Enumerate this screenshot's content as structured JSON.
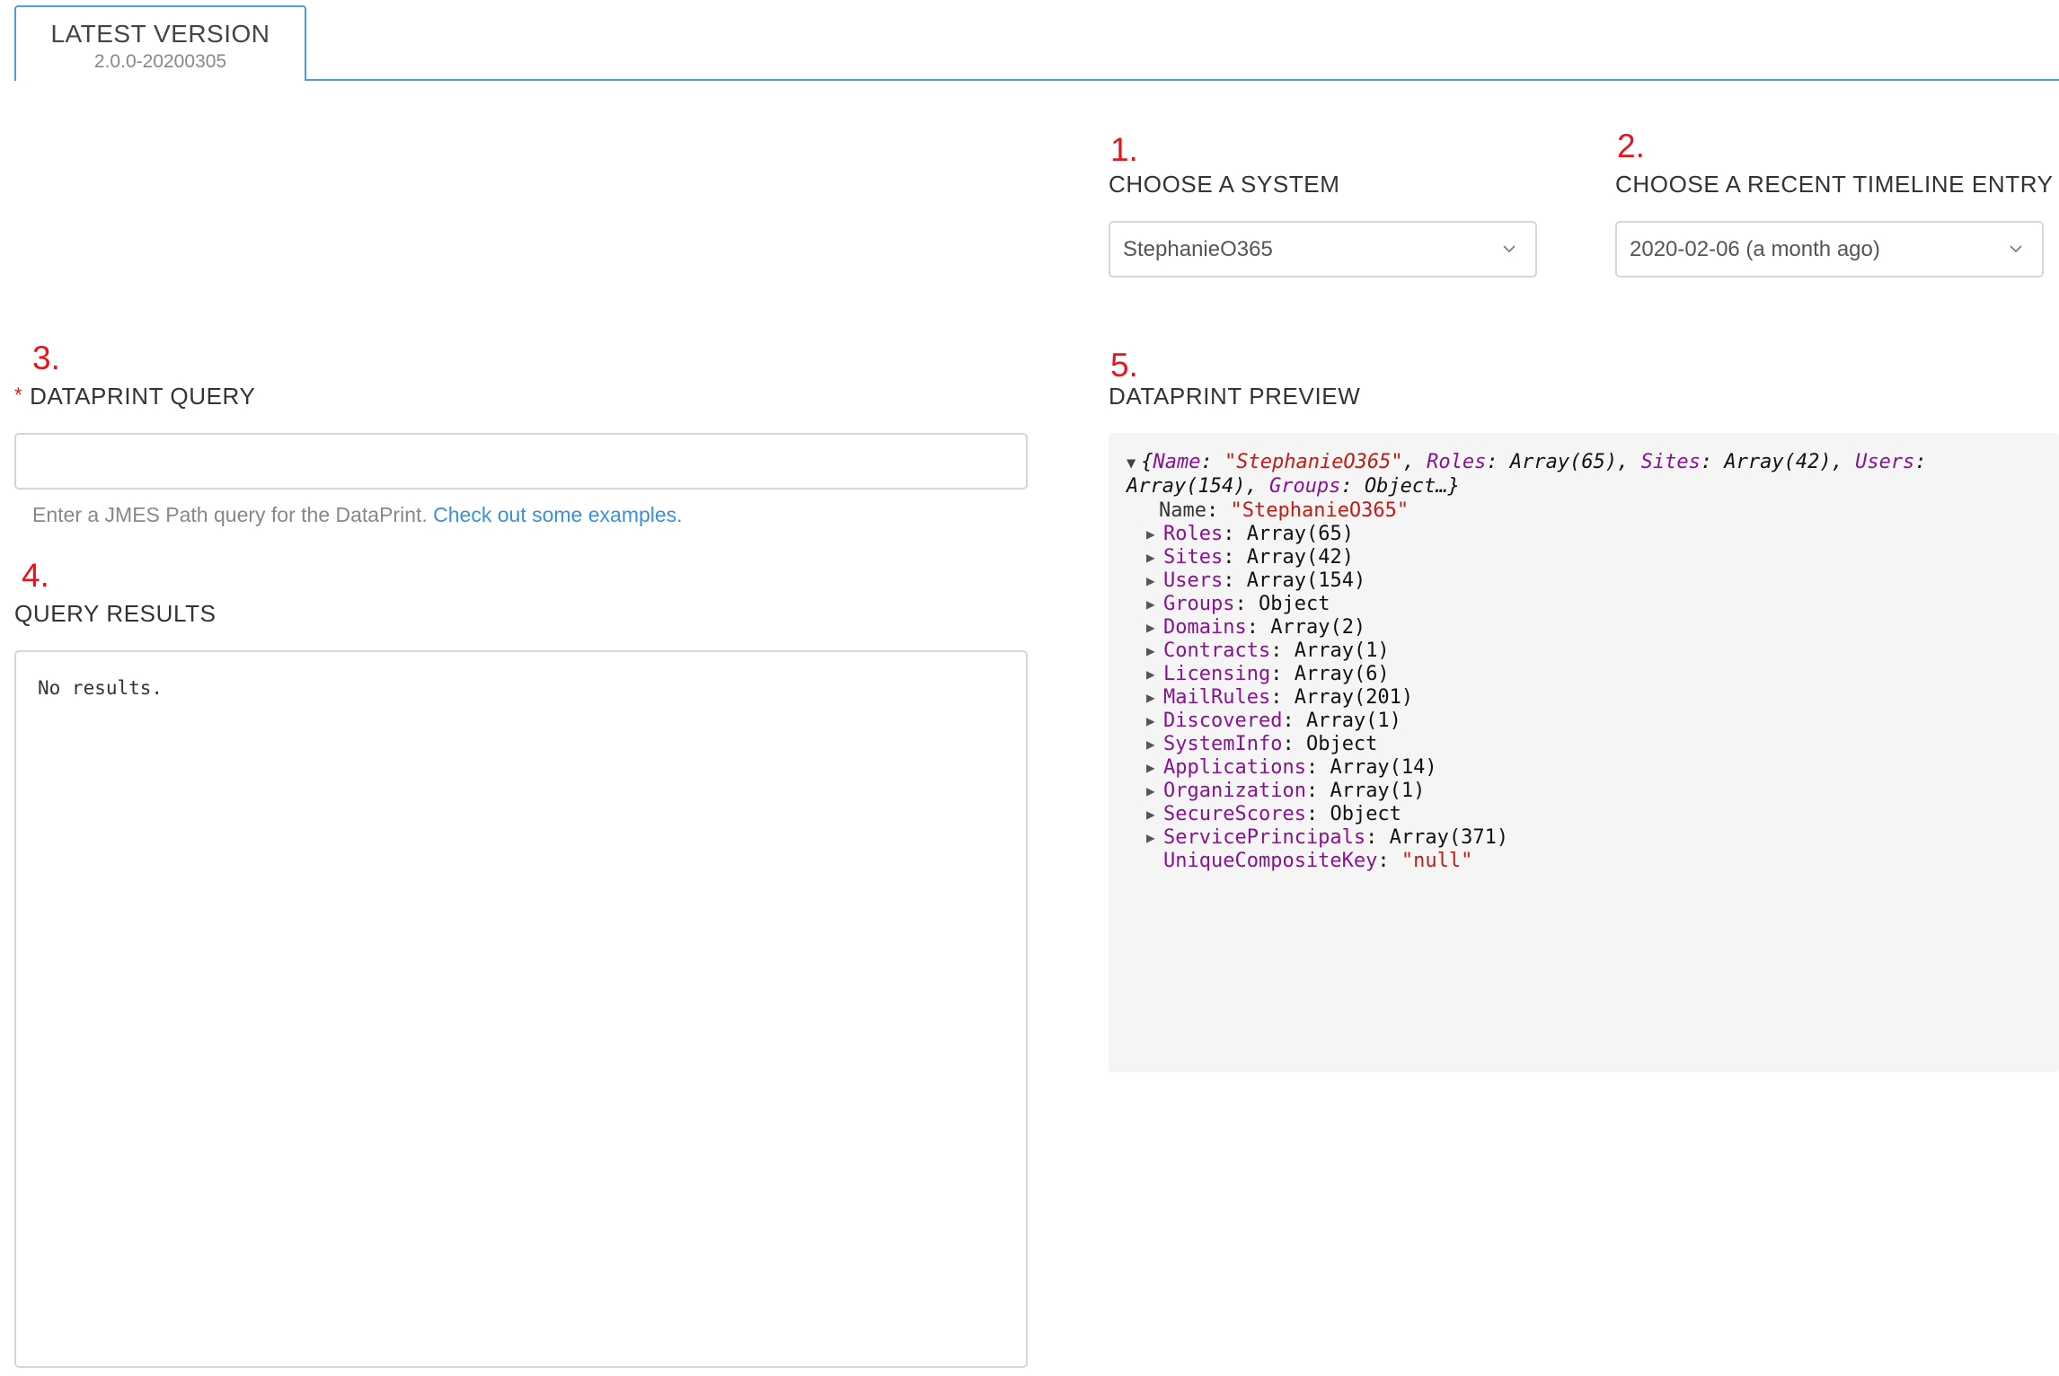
{
  "tab": {
    "title": "LATEST VERSION",
    "version": "2.0.0-20200305"
  },
  "steps": {
    "s1": "1.",
    "s2": "2.",
    "s3": "3.",
    "s4": "4.",
    "s5": "5."
  },
  "system": {
    "label": "CHOOSE A SYSTEM",
    "selected": "StephanieO365"
  },
  "timeline": {
    "label": "CHOOSE A RECENT TIMELINE ENTRY",
    "selected": "2020-02-06 (a month ago)"
  },
  "query": {
    "required_mark": "*",
    "label": "DATAPRINT QUERY",
    "value": "",
    "help_text": "Enter a JMES Path query for the DataPrint.",
    "help_link": "Check out some examples."
  },
  "results": {
    "label": "QUERY RESULTS",
    "text": "No results."
  },
  "preview": {
    "label": "DATAPRINT PREVIEW",
    "summary": [
      {
        "k": "Name",
        "v": "\"StephanieO365\"",
        "type": "string"
      },
      {
        "k": "Roles",
        "v": "Array(65)",
        "type": "value"
      },
      {
        "k": "Sites",
        "v": "Array(42)",
        "type": "value"
      },
      {
        "k": "Users",
        "v": "Array(154)",
        "type": "value"
      },
      {
        "k": "Groups",
        "v": "Object…",
        "type": "value"
      }
    ],
    "rows": [
      {
        "key": "Name",
        "value": "\"StephanieO365\"",
        "expandable": false,
        "type": "string"
      },
      {
        "key": "Roles",
        "value": "Array(65)",
        "expandable": true,
        "type": "value"
      },
      {
        "key": "Sites",
        "value": "Array(42)",
        "expandable": true,
        "type": "value"
      },
      {
        "key": "Users",
        "value": "Array(154)",
        "expandable": true,
        "type": "value"
      },
      {
        "key": "Groups",
        "value": "Object",
        "expandable": true,
        "type": "value"
      },
      {
        "key": "Domains",
        "value": "Array(2)",
        "expandable": true,
        "type": "value"
      },
      {
        "key": "Contracts",
        "value": "Array(1)",
        "expandable": true,
        "type": "value"
      },
      {
        "key": "Licensing",
        "value": "Array(6)",
        "expandable": true,
        "type": "value"
      },
      {
        "key": "MailRules",
        "value": "Array(201)",
        "expandable": true,
        "type": "value"
      },
      {
        "key": "Discovered",
        "value": "Array(1)",
        "expandable": true,
        "type": "value"
      },
      {
        "key": "SystemInfo",
        "value": "Object",
        "expandable": true,
        "type": "value"
      },
      {
        "key": "Applications",
        "value": "Array(14)",
        "expandable": true,
        "type": "value"
      },
      {
        "key": "Organization",
        "value": "Array(1)",
        "expandable": true,
        "type": "value"
      },
      {
        "key": "SecureScores",
        "value": "Object",
        "expandable": true,
        "type": "value"
      },
      {
        "key": "ServicePrincipals",
        "value": "Array(371)",
        "expandable": true,
        "type": "value"
      },
      {
        "key": "UniqueCompositeKey",
        "value": "\"null\"",
        "expandable": false,
        "type": "string"
      }
    ]
  },
  "colors": {
    "accent": "#4a9fd8",
    "annotation": "#e8141b",
    "json_key": "#881391",
    "json_string": "#c41a16",
    "link": "#3b8fdb"
  },
  "icons": {
    "expand": "triangle-right-icon",
    "collapse": "triangle-down-icon",
    "dropdown": "chevron-down-icon"
  }
}
